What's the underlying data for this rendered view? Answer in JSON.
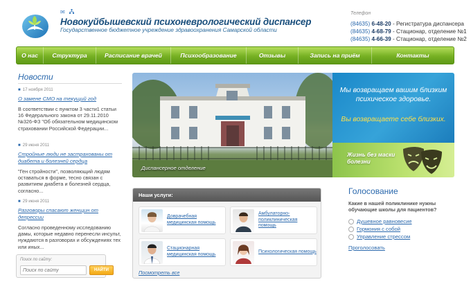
{
  "header": {
    "site_title": "Новокуйбышевский психоневрологический диспансер",
    "site_subtitle": "Государственное бюджетное учреждение здравоохранения Самарской области",
    "phone_label": "Телефон",
    "phones": [
      {
        "code": "(84635)",
        "number": "6-48-20",
        "desc": " - Регистратура диспансера"
      },
      {
        "code": "(84635)",
        "number": "4-68-79",
        "desc": " - Стационар, отделение №1"
      },
      {
        "code": "(84635)",
        "number": "4-66-39",
        "desc": " - Стационар, отделение №2"
      }
    ]
  },
  "nav": {
    "items": [
      "О нас",
      "Структура",
      "Расписание врачей",
      "Психообразование",
      "Отзывы",
      "Запись на приём",
      "Контакты"
    ]
  },
  "news": {
    "title": "Новости",
    "items": [
      {
        "date": "17 ноября 2011",
        "link": "О замене СМО на текущий год",
        "text": "В соответствии с пунктом 3 части1 статьи 16 Федерального закона от 29.11.2010 №326-ФЗ \"Об обязательном медицинском страховании Российской Федерации..."
      },
      {
        "date": "29 июня 2011",
        "link": "Стройные люди не застрахованы от диабета и болезней сердца",
        "text": "\"Ген стройности\", позволяющий людям оставаться в форме, тесно связан с развитием диабета и болезней сердца, согласно..."
      },
      {
        "date": "29 июня 2011",
        "link": "Разговоры спасают женщин от депрессии",
        "text": "Согласно проведенному исследованию дамы, которые недавно перенесли инсульт, нуждаются в разговорах и обсуждениях тех или иных..."
      }
    ]
  },
  "search": {
    "label": "Поиск по сайту:",
    "placeholder": "Поиск по сайту",
    "button": "НАЙТИ"
  },
  "banner": {
    "caption": "Диспансерное отделение",
    "text1": "Мы возвращаем вашим близким психическое здоровье.",
    "text2": "Вы возвращаете себе близких.",
    "text3": "Жизнь без маски болезни"
  },
  "services": {
    "title": "Наши услуги:",
    "items": [
      {
        "label": "Доврачебная медицинская помощь"
      },
      {
        "label": "Амбулаторно-поликлиническая помощь"
      },
      {
        "label": "Стационарная медицинская помощь"
      },
      {
        "label": "Психологическая помощь"
      }
    ],
    "all_link": "Посмотреть все"
  },
  "vote": {
    "title": "Голосование",
    "question": "Какие в нашей поликлинике нужны обучающие школы для пациентов?",
    "options": [
      "Душевное равновесие",
      "Гормония с собой",
      "Управление стрессом"
    ],
    "button": "Проголосовать"
  },
  "colors": {
    "accent_blue": "#2b69ad",
    "nav_green": "#76b023",
    "button_orange": "#f3a915"
  }
}
